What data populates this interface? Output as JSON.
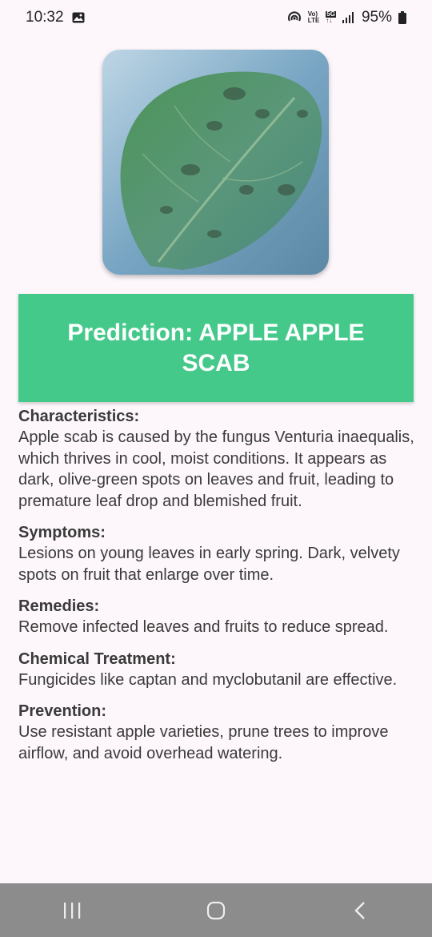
{
  "status": {
    "time": "10:32",
    "battery": "95%",
    "volte_top": "Vo)",
    "volte_bottom": "LTE",
    "net_top": "5G",
    "net_bottom": "↑↓"
  },
  "image": {
    "alt": "leaf-photo"
  },
  "prediction": {
    "text": "Prediction: APPLE APPLE SCAB"
  },
  "sections": [
    {
      "heading": "Characteristics:",
      "body": "Apple scab is caused by the fungus Venturia inaequalis, which thrives in cool, moist conditions. It appears as dark, olive-green spots on leaves and fruit, leading to premature leaf drop and blemished fruit."
    },
    {
      "heading": "Symptoms:",
      "body": "Lesions on young leaves in early spring. Dark, velvety spots on fruit that enlarge over time."
    },
    {
      "heading": "Remedies:",
      "body": "Remove infected leaves and fruits to reduce spread."
    },
    {
      "heading": "Chemical Treatment:",
      "body": "Fungicides like captan and myclobutanil are effective."
    },
    {
      "heading": "Prevention:",
      "body": "Use resistant apple varieties, prune trees to improve airflow, and avoid overhead watering."
    }
  ],
  "colors": {
    "accent": "#45c98b",
    "background": "#fdf7fb",
    "navbar": "#8c8c8c"
  },
  "icons": {
    "status": [
      "gallery-icon",
      "hotspot-icon",
      "signal-icon",
      "battery-icon"
    ],
    "nav": [
      "recents-icon",
      "home-icon",
      "back-icon"
    ]
  }
}
